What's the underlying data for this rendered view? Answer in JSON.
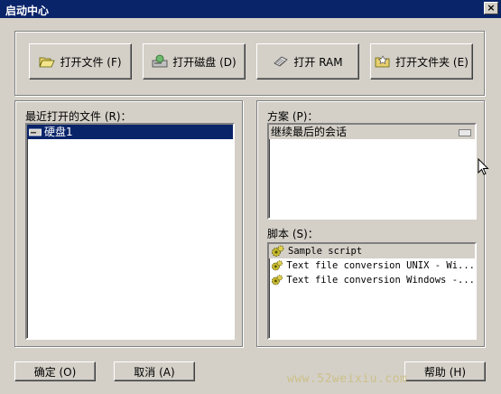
{
  "window": {
    "title": "启动中心",
    "close_glyph": "×"
  },
  "toolbar": {
    "open_file": "打开文件 (F)",
    "open_disk": "打开磁盘 (D)",
    "open_ram": "打开 RAM",
    "open_folder": "打开文件夹 (E)"
  },
  "recent": {
    "label": "最近打开的文件 (R)：",
    "items": [
      {
        "label": "硬盘1",
        "selected": true
      }
    ]
  },
  "scheme": {
    "label": "方案 (P)：",
    "items": [
      {
        "label": "继续最后的会话"
      }
    ]
  },
  "scripts": {
    "label": "脚本 (S)：",
    "items": [
      {
        "label": "Sample script"
      },
      {
        "label": "Text file conversion UNIX - Wi..."
      },
      {
        "label": "Text file conversion Windows -..."
      }
    ]
  },
  "footer": {
    "ok": "确定 (O)",
    "cancel": "取消 (A)",
    "help": "帮助 (H)"
  },
  "watermark": "www.52weixiu.com"
}
